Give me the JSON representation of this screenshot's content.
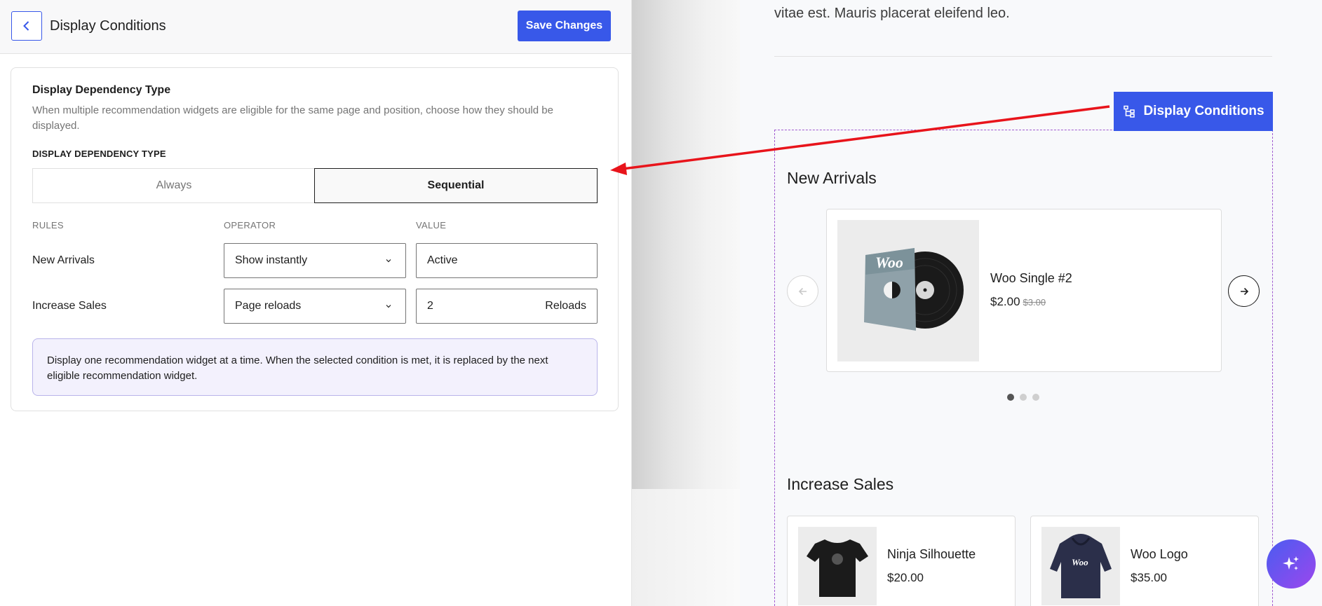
{
  "header": {
    "title": "Display Conditions",
    "save_label": "Save Changes"
  },
  "card": {
    "heading": "Display Dependency Type",
    "description": "When multiple recommendation widgets are eligible for the same page and position, choose how they should be displayed.",
    "section_label": "DISPLAY DEPENDENCY TYPE",
    "toggle": {
      "options": [
        "Always",
        "Sequential"
      ],
      "selected": "Sequential"
    },
    "columns": {
      "rules": "RULES",
      "operator": "OPERATOR",
      "value": "VALUE"
    },
    "rules": [
      {
        "name": "New Arrivals",
        "operator": "Show instantly",
        "value": "Active",
        "suffix": ""
      },
      {
        "name": "Increase Sales",
        "operator": "Page reloads",
        "value": "2",
        "suffix": "Reloads"
      }
    ],
    "info": "Display one recommendation widget at a time. When the selected condition is met, it is replaced by the next eligible recommendation widget."
  },
  "preview": {
    "intro_text": "vitae est. Mauris placerat eleifend leo.",
    "display_conditions_label": "Display Conditions",
    "new_arrivals": {
      "title": "New Arrivals",
      "product": {
        "name": "Woo Single #2",
        "price": "$2.00",
        "old_price": "$3.00",
        "image_text": "Woo"
      },
      "slide_count": 3,
      "active_slide": 1
    },
    "increase_sales": {
      "title": "Increase Sales",
      "products": [
        {
          "name": "Ninja Silhouette",
          "price": "$20.00"
        },
        {
          "name": "Woo Logo",
          "price": "$35.00",
          "image_text": "Woo"
        }
      ]
    }
  },
  "colors": {
    "accent": "#3858e9",
    "annotation_arrow": "#e8141b",
    "dashed_border": "#a05ad0"
  },
  "icons": [
    "chevron-left-icon",
    "chevron-down-icon",
    "hierarchy-icon",
    "arrow-left-icon",
    "arrow-right-icon",
    "sparkle-icon"
  ]
}
